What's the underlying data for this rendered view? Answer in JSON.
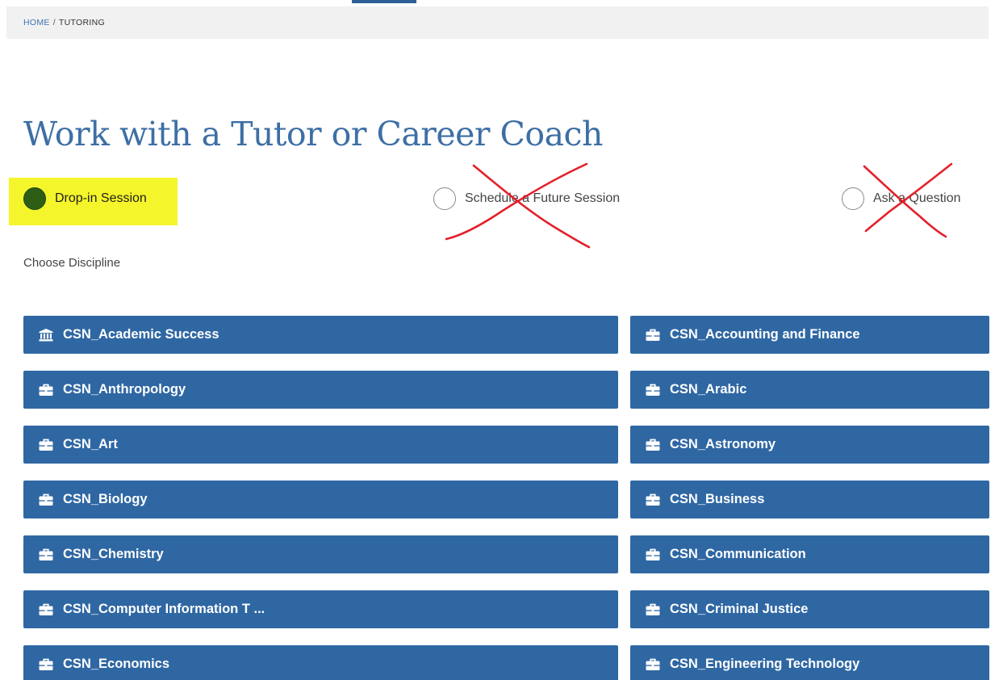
{
  "breadcrumb": {
    "home": "HOME",
    "separator": "/",
    "current": "TUTORING"
  },
  "page_title": "Work with a Tutor or Career Coach",
  "session_options": [
    {
      "label": "Drop-in Session",
      "selected": true,
      "highlighted": true
    },
    {
      "label": "Schedule a Future Session",
      "selected": false,
      "crossed_out": true
    },
    {
      "label": "Ask a Question",
      "selected": false,
      "crossed_out": true
    }
  ],
  "choose_label": "Choose Discipline",
  "disciplines": [
    {
      "label": "CSN_Academic Success",
      "icon": "institution-icon"
    },
    {
      "label": "CSN_Accounting and Finance",
      "icon": "briefcase-icon"
    },
    {
      "label": "CSN_Anthropology",
      "icon": "briefcase-icon"
    },
    {
      "label": "CSN_Arabic",
      "icon": "briefcase-icon"
    },
    {
      "label": "CSN_Art",
      "icon": "briefcase-icon"
    },
    {
      "label": "CSN_Astronomy",
      "icon": "briefcase-icon"
    },
    {
      "label": "CSN_Biology",
      "icon": "briefcase-icon"
    },
    {
      "label": "CSN_Business",
      "icon": "briefcase-icon"
    },
    {
      "label": "CSN_Chemistry",
      "icon": "briefcase-icon"
    },
    {
      "label": "CSN_Communication",
      "icon": "briefcase-icon"
    },
    {
      "label": "CSN_Computer Information T ...",
      "icon": "briefcase-icon"
    },
    {
      "label": "CSN_Criminal Justice",
      "icon": "briefcase-icon"
    },
    {
      "label": "CSN_Economics",
      "icon": "briefcase-icon"
    },
    {
      "label": "CSN_Engineering Technology",
      "icon": "briefcase-icon"
    }
  ],
  "colors": {
    "title": "#3d6fa5",
    "button": "#2f67a3",
    "selected_radio": "#2e5e16",
    "highlighter": "#f5f52b",
    "cross_mark": "#e3202a"
  }
}
